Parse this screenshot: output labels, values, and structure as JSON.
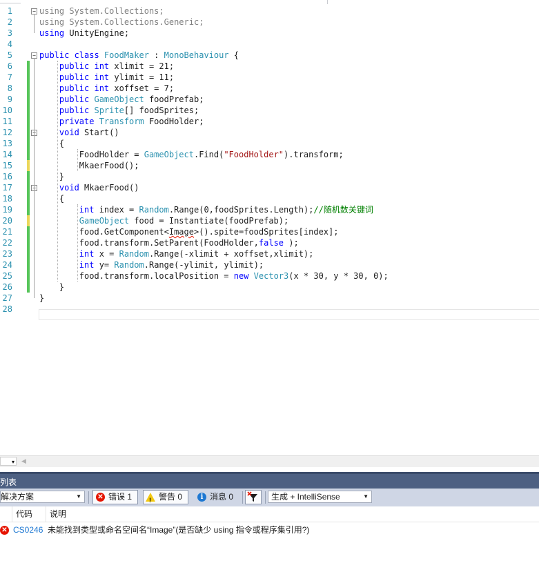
{
  "editor": {
    "lines": [
      {
        "n": "1",
        "tokens": [
          {
            "t": "using",
            "c": "kw dim"
          },
          {
            "t": " System.Collections;",
            "c": "dim"
          }
        ]
      },
      {
        "n": "2",
        "tokens": [
          {
            "t": "using",
            "c": "kw dim"
          },
          {
            "t": " System.Collections.Generic;",
            "c": "dim"
          }
        ]
      },
      {
        "n": "3",
        "tokens": [
          {
            "t": "using",
            "c": "kw"
          },
          {
            "t": " UnityEngine;",
            "c": ""
          }
        ]
      },
      {
        "n": "4",
        "tokens": []
      },
      {
        "n": "5",
        "tokens": [
          {
            "t": "public class ",
            "c": "kw"
          },
          {
            "t": "FoodMaker",
            "c": "ty"
          },
          {
            "t": " : ",
            "c": ""
          },
          {
            "t": "MonoBehaviour",
            "c": "ty"
          },
          {
            "t": " {",
            "c": ""
          }
        ]
      },
      {
        "n": "6",
        "tokens": [
          {
            "t": "    public int",
            "c": "kw"
          },
          {
            "t": " xlimit = 21;",
            "c": ""
          }
        ]
      },
      {
        "n": "7",
        "tokens": [
          {
            "t": "    public int",
            "c": "kw"
          },
          {
            "t": " ylimit = 11;",
            "c": ""
          }
        ]
      },
      {
        "n": "8",
        "tokens": [
          {
            "t": "    public int",
            "c": "kw"
          },
          {
            "t": " xoffset = 7;",
            "c": ""
          }
        ]
      },
      {
        "n": "9",
        "tokens": [
          {
            "t": "    public ",
            "c": "kw"
          },
          {
            "t": "GameObject",
            "c": "ty"
          },
          {
            "t": " foodPrefab;",
            "c": ""
          }
        ]
      },
      {
        "n": "10",
        "tokens": [
          {
            "t": "    public ",
            "c": "kw"
          },
          {
            "t": "Sprite",
            "c": "ty"
          },
          {
            "t": "[] foodSprites;",
            "c": ""
          }
        ]
      },
      {
        "n": "11",
        "tokens": [
          {
            "t": "    private ",
            "c": "kw"
          },
          {
            "t": "Transform",
            "c": "ty"
          },
          {
            "t": " FoodHolder;",
            "c": ""
          }
        ]
      },
      {
        "n": "12",
        "tokens": [
          {
            "t": "    void",
            "c": "kw"
          },
          {
            "t": " Start()",
            "c": ""
          }
        ]
      },
      {
        "n": "13",
        "tokens": [
          {
            "t": "    {",
            "c": ""
          }
        ]
      },
      {
        "n": "14",
        "tokens": [
          {
            "t": "        FoodHolder = ",
            "c": ""
          },
          {
            "t": "GameObject",
            "c": "ty"
          },
          {
            "t": ".Find(",
            "c": ""
          },
          {
            "t": "\"FoodHolder\"",
            "c": "st"
          },
          {
            "t": ").transform;",
            "c": ""
          }
        ]
      },
      {
        "n": "15",
        "tokens": [
          {
            "t": "        MkaerFood();",
            "c": ""
          }
        ]
      },
      {
        "n": "16",
        "tokens": [
          {
            "t": "    }",
            "c": ""
          }
        ]
      },
      {
        "n": "17",
        "tokens": [
          {
            "t": "    void",
            "c": "kw"
          },
          {
            "t": " MkaerFood()",
            "c": ""
          }
        ]
      },
      {
        "n": "18",
        "tokens": [
          {
            "t": "    {",
            "c": ""
          }
        ]
      },
      {
        "n": "19",
        "tokens": [
          {
            "t": "        int",
            "c": "kw"
          },
          {
            "t": " index = ",
            "c": ""
          },
          {
            "t": "Random",
            "c": "ty"
          },
          {
            "t": ".Range(0,foodSprites.Length);",
            "c": ""
          },
          {
            "t": "//随机数关键词",
            "c": "cm"
          }
        ]
      },
      {
        "n": "20",
        "tokens": [
          {
            "t": "        GameObject",
            "c": "ty"
          },
          {
            "t": " food = Instantiate(foodPrefab);",
            "c": ""
          }
        ]
      },
      {
        "n": "21",
        "tokens": [
          {
            "t": "        food.GetComponent<",
            "c": ""
          },
          {
            "t": "Image",
            "c": "squiggle"
          },
          {
            "t": ">().spite=foodSprites[index];",
            "c": ""
          }
        ]
      },
      {
        "n": "22",
        "tokens": [
          {
            "t": "        food.transform.SetParent(FoodHolder,",
            "c": ""
          },
          {
            "t": "false",
            "c": "kw"
          },
          {
            "t": " );",
            "c": ""
          }
        ]
      },
      {
        "n": "23",
        "tokens": [
          {
            "t": "        int",
            "c": "kw"
          },
          {
            "t": " x = ",
            "c": ""
          },
          {
            "t": "Random",
            "c": "ty"
          },
          {
            "t": ".Range(-xlimit + xoffset,xlimit);",
            "c": ""
          }
        ]
      },
      {
        "n": "24",
        "tokens": [
          {
            "t": "        int",
            "c": "kw"
          },
          {
            "t": " y= ",
            "c": ""
          },
          {
            "t": "Random",
            "c": "ty"
          },
          {
            "t": ".Range(-ylimit, ylimit);",
            "c": ""
          }
        ]
      },
      {
        "n": "25",
        "tokens": [
          {
            "t": "        food.transform.localPosition = ",
            "c": ""
          },
          {
            "t": "new ",
            "c": "kw"
          },
          {
            "t": "Vector3",
            "c": "ty"
          },
          {
            "t": "(x * 30, y * 30, 0);",
            "c": ""
          }
        ]
      },
      {
        "n": "26",
        "tokens": [
          {
            "t": "    }",
            "c": ""
          }
        ]
      },
      {
        "n": "27",
        "tokens": [
          {
            "t": "}",
            "c": ""
          }
        ]
      },
      {
        "n": "28",
        "tokens": []
      }
    ],
    "change_marks": {
      "6": "g",
      "7": "g",
      "8": "g",
      "9": "g",
      "10": "g",
      "11": "g",
      "12": "g",
      "13": "g",
      "14": "g",
      "15": "y",
      "16": "g",
      "17": "g",
      "18": "g",
      "19": "g",
      "20": "y",
      "21": "g",
      "22": "g",
      "23": "g",
      "24": "g",
      "25": "g",
      "26": "g"
    },
    "fold_markers": {
      "1": "−",
      "5": "−",
      "12": "−",
      "17": "−"
    },
    "colors": {
      "keyword": "#0000ff",
      "type": "#2b91af",
      "string": "#a31515",
      "comment": "#008000",
      "line_number": "#2b91af",
      "change_saved": "#57c55a",
      "change_unsaved": "#ebd75a"
    }
  },
  "error_list": {
    "title": "列表",
    "scope_dropdown": "解决方案",
    "errors_button": "错误 1",
    "warnings_button": "警告 0",
    "messages_button": "消息 0",
    "build_filter": "生成 + IntelliSense",
    "columns": {
      "code": "代码",
      "description": "说明"
    },
    "rows": [
      {
        "code": "CS0246",
        "description": "未能找到类型或命名空间名“Image”(是否缺少 using 指令或程序集引用?)"
      }
    ]
  }
}
